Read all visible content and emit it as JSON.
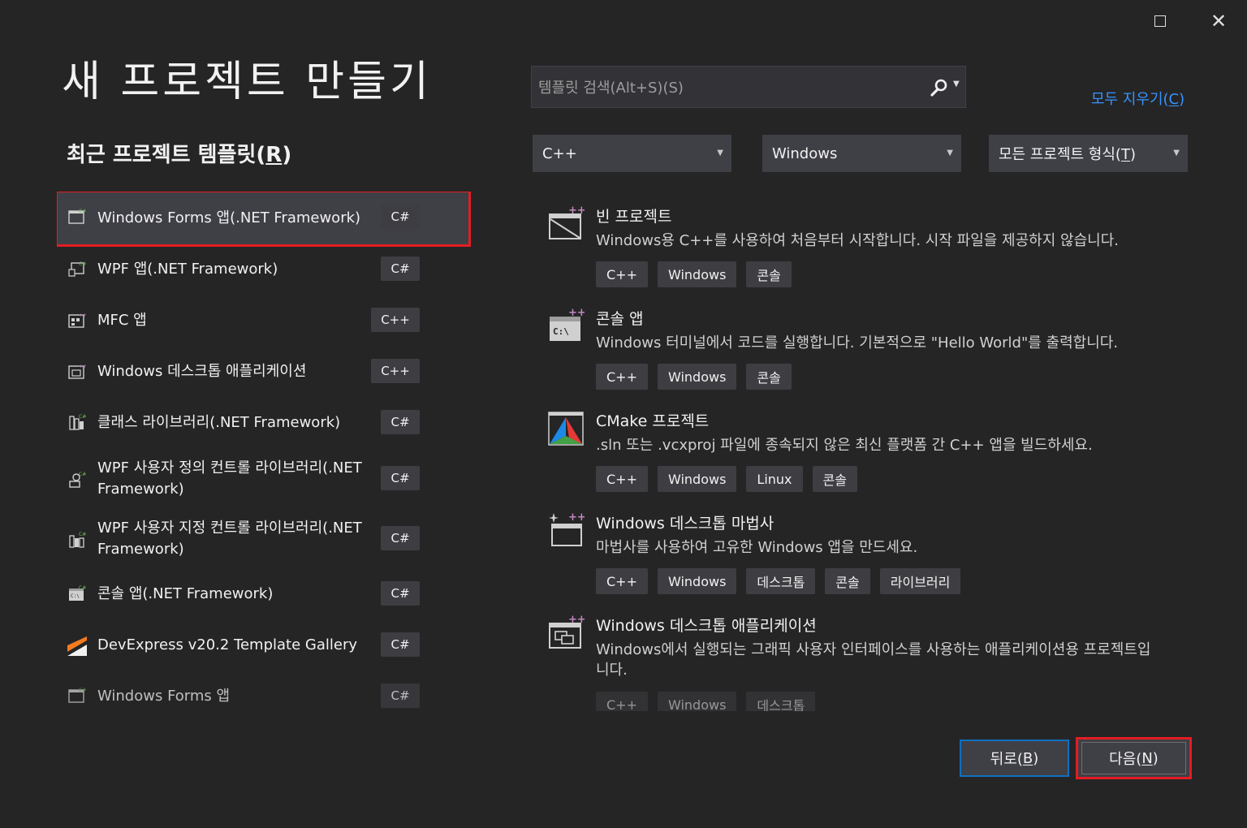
{
  "window": {
    "maximize_icon": "maximize-icon",
    "close_glyph": "✕"
  },
  "page": {
    "title": "새 프로젝트 만들기",
    "recent_title": "최근 프로젝트 템플릿(R)"
  },
  "recent_templates": [
    {
      "label": "Windows Forms 앱(.NET Framework)",
      "lang": "C#",
      "icon": "winforms-icon",
      "selected": true
    },
    {
      "label": "WPF 앱(.NET Framework)",
      "lang": "C#",
      "icon": "wpf-app-icon"
    },
    {
      "label": "MFC 앱",
      "lang": "C++",
      "icon": "mfc-app-icon"
    },
    {
      "label": "Windows 데스크톱 애플리케이션",
      "lang": "C++",
      "icon": "desktop-app-icon"
    },
    {
      "label": "클래스 라이브러리(.NET Framework)",
      "lang": "C#",
      "icon": "class-library-icon"
    },
    {
      "label": "WPF 사용자 정의 컨트롤 라이브러리(.NET Framework)",
      "lang": "C#",
      "icon": "wpf-custom-control-icon"
    },
    {
      "label": "WPF 사용자 지정 컨트롤 라이브러리(.NET Framework)",
      "lang": "C#",
      "icon": "wpf-user-control-icon"
    },
    {
      "label": "콘솔 앱(.NET Framework)",
      "lang": "C#",
      "icon": "console-app-icon"
    },
    {
      "label": "DevExpress v20.2 Template Gallery",
      "lang": "C#",
      "icon": "devexpress-icon"
    },
    {
      "label": "Windows Forms 앱",
      "lang": "C#",
      "icon": "winforms-icon"
    }
  ],
  "search": {
    "placeholder": "템플릿 검색(Alt+S)(S)",
    "clear_all": "모두 지우기(C)"
  },
  "filters": {
    "language": "C++",
    "platform": "Windows",
    "project_type": "모든 프로젝트 형식(T)"
  },
  "templates": [
    {
      "name": "빈 프로젝트",
      "desc": "Windows용 C++를 사용하여 처음부터 시작합니다. 시작 파일을 제공하지 않습니다.",
      "tags": [
        "C++",
        "Windows",
        "콘솔"
      ],
      "icon": "empty-project-icon"
    },
    {
      "name": "콘솔 앱",
      "desc": "Windows 터미널에서 코드를 실행합니다. 기본적으로 \"Hello World\"를 출력합니다.",
      "tags": [
        "C++",
        "Windows",
        "콘솔"
      ],
      "icon": "console-app-icon"
    },
    {
      "name": "CMake 프로젝트",
      "desc": ".sln 또는 .vcxproj 파일에 종속되지 않은 최신 플랫폼 간 C++ 앱을 빌드하세요.",
      "tags": [
        "C++",
        "Windows",
        "Linux",
        "콘솔"
      ],
      "icon": "cmake-icon"
    },
    {
      "name": "Windows 데스크톱 마법사",
      "desc": "마법사를 사용하여 고유한 Windows 앱을 만드세요.",
      "tags": [
        "C++",
        "Windows",
        "데스크톱",
        "콘솔",
        "라이브러리"
      ],
      "icon": "desktop-wizard-icon"
    },
    {
      "name": "Windows 데스크톱 애플리케이션",
      "desc": "Windows에서 실행되는 그래픽 사용자 인터페이스를 사용하는 애플리케이션용 프로젝트입니다.",
      "tags": [
        "C++",
        "Windows",
        "데스크톱"
      ],
      "icon": "desktop-app-icon"
    }
  ],
  "buttons": {
    "back": "뒤로(B)",
    "next": "다음(N)"
  },
  "colors": {
    "background": "#252526",
    "accent_link": "#3794ff",
    "highlight_red": "#e51c23",
    "button_blue_border": "#0e70c0"
  }
}
